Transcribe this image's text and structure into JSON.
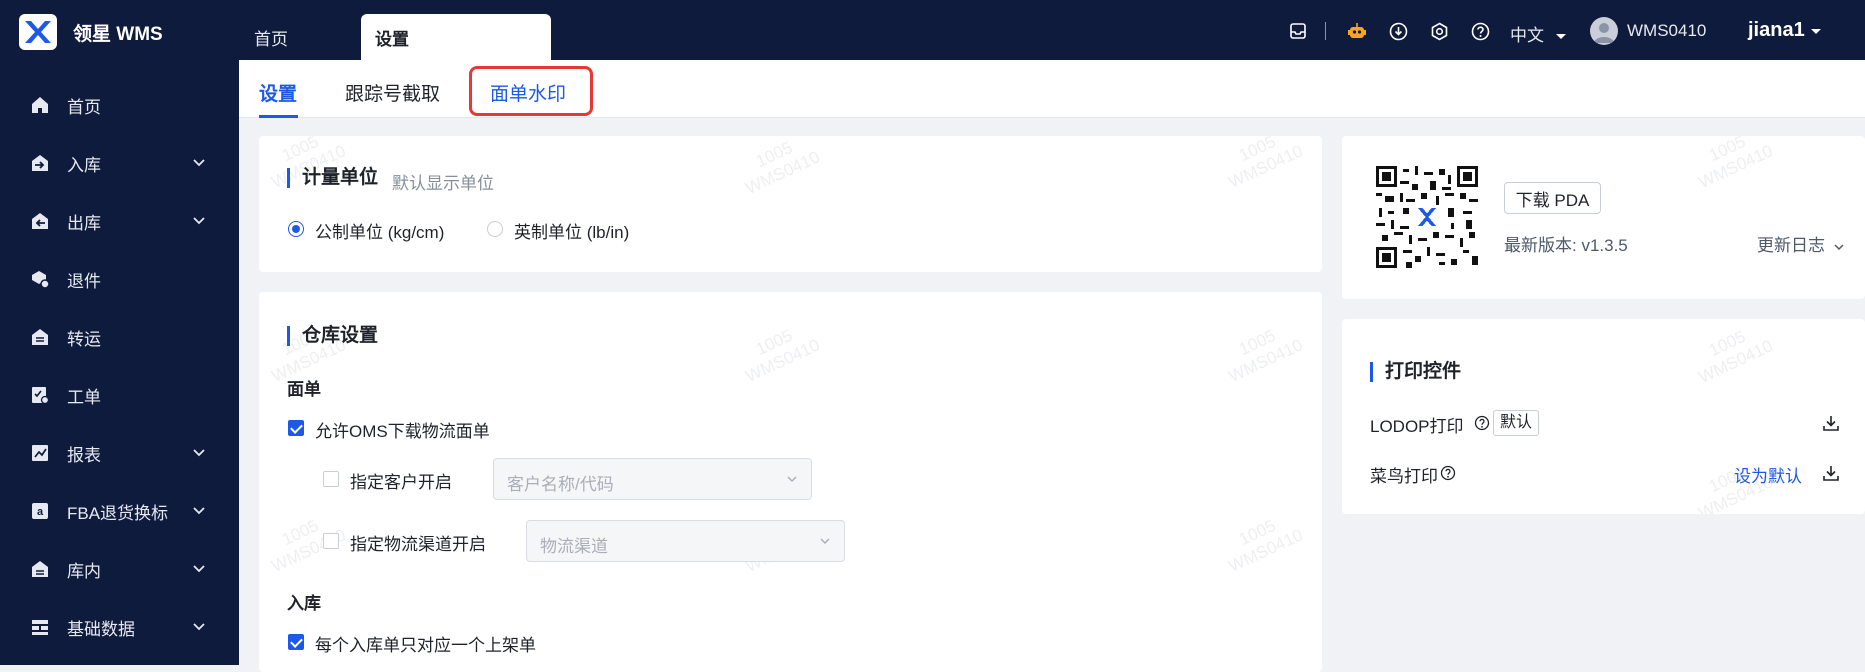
{
  "topbar": {
    "brand": "领星 WMS",
    "tabs": [
      {
        "label": "首页"
      },
      {
        "label": "设置"
      }
    ],
    "language": "中文",
    "account": "WMS0410",
    "user": "jiana1"
  },
  "sidebar": {
    "items": [
      {
        "label": "首页",
        "icon": "home-icon",
        "expandable": false
      },
      {
        "label": "入库",
        "icon": "inbound-icon",
        "expandable": true
      },
      {
        "label": "出库",
        "icon": "outbound-icon",
        "expandable": true
      },
      {
        "label": "退件",
        "icon": "return-icon",
        "expandable": false
      },
      {
        "label": "转运",
        "icon": "transfer-icon",
        "expandable": false
      },
      {
        "label": "工单",
        "icon": "work-order-icon",
        "expandable": false
      },
      {
        "label": "报表",
        "icon": "report-icon",
        "expandable": true
      },
      {
        "label": "FBA退货换标",
        "icon": "amazon-icon",
        "expandable": true
      },
      {
        "label": "库内",
        "icon": "warehouse-icon",
        "expandable": true
      },
      {
        "label": "基础数据",
        "icon": "data-icon",
        "expandable": true
      }
    ]
  },
  "subtabs": [
    {
      "label": "设置"
    },
    {
      "label": "跟踪号截取"
    },
    {
      "label": "面单水印"
    }
  ],
  "units": {
    "title": "计量单位",
    "hint": "默认显示单位",
    "metric": "公制单位 (kg/cm)",
    "imperial": "英制单位 (lb/in)",
    "selected": "metric"
  },
  "warehouse": {
    "title": "仓库设置",
    "label_section": "面单",
    "allow_oms": "允许OMS下载物流面单",
    "customer_enable": "指定客户开启",
    "customer_placeholder": "客户名称/代码",
    "channel_enable": "指定物流渠道开启",
    "channel_placeholder": "物流渠道",
    "inbound_section": "入库",
    "inbound_rule": "每个入库单只对应一个上架单"
  },
  "pda": {
    "download": "下载 PDA",
    "version": "最新版本: v1.3.5",
    "changelog": "更新日志"
  },
  "print": {
    "title": "打印控件",
    "lodop": "LODOP打印",
    "lodop_badge": "默认",
    "cainiao": "菜鸟打印",
    "set_default": "设为默认"
  },
  "watermark": {
    "line1": "1005",
    "line2": "WMS0410"
  },
  "colors": {
    "nav_bg": "#0f1b3d",
    "accent": "#1e58e8",
    "highlight": "#e53935"
  }
}
